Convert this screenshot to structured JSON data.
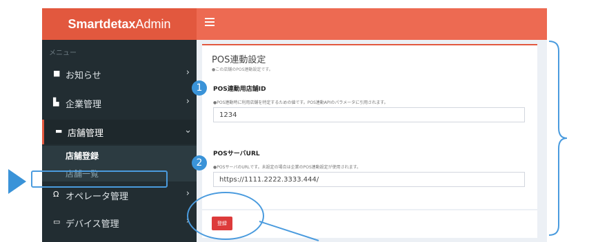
{
  "header": {
    "brand_bold": "Smartdetax",
    "brand_light": "Admin"
  },
  "sidebar": {
    "menu_header": "メニュー",
    "items": [
      {
        "label": "お知らせ",
        "icon": "chat-bubble-icon"
      },
      {
        "label": "企業管理",
        "icon": "building-icon"
      },
      {
        "label": "店舗管理",
        "icon": "store-icon",
        "expanded": true
      },
      {
        "label": "オペレータ管理",
        "icon": "headset-icon"
      },
      {
        "label": "デバイス管理",
        "icon": "device-icon"
      }
    ],
    "sub_items": [
      {
        "label": "店舗登録",
        "current": true
      },
      {
        "label": "店舗一覧",
        "current": false
      }
    ]
  },
  "form": {
    "title": "POS連動設定",
    "subtitle": "●この店舗のPOS連動設定です。",
    "fields": [
      {
        "badge": "1",
        "label": "POS連動用店舗ID",
        "help": "●POS連動時に利用店舗を特定するための値です。POS連動APIのパラメータに引用されます。",
        "value": "1234"
      },
      {
        "badge": "2",
        "label": "POSサーバURL",
        "help": "●POSサーバのURLです。未設定の場合は企業のPOS連動設定が使用されます。",
        "value": "https://1111.2222.3333.444/"
      }
    ],
    "submit_label": "登録"
  },
  "colors": {
    "header_left": "#e2583e",
    "header_right": "#ed6a52",
    "sidebar_bg": "#222d32",
    "annotation_blue": "#3a93d8",
    "submit_red": "#dd3b3b"
  }
}
